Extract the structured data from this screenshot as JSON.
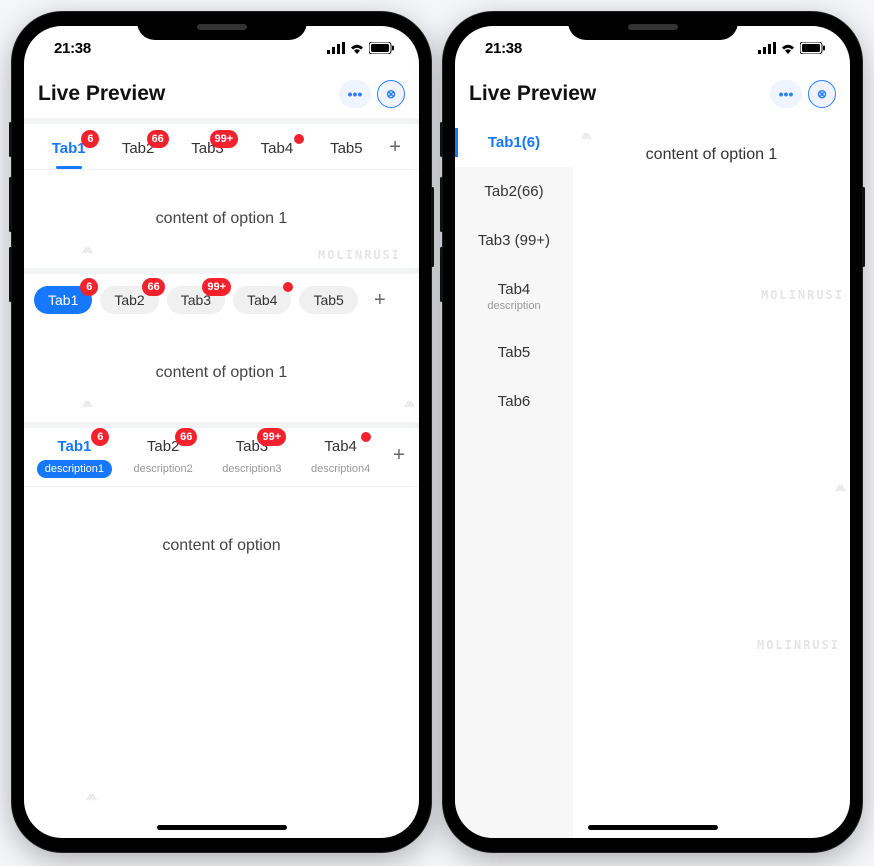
{
  "status": {
    "time": "21:38"
  },
  "header": {
    "title": "Live Preview",
    "more_label": "•••",
    "close_label": "⊗"
  },
  "phone1": {
    "section1": {
      "tabs": [
        {
          "label": "Tab1",
          "badge": "6",
          "active": true
        },
        {
          "label": "Tab2",
          "badge": "66"
        },
        {
          "label": "Tab3",
          "badge": "99+"
        },
        {
          "label": "Tab4",
          "dot": true
        },
        {
          "label": "Tab5"
        }
      ],
      "content": "content of option 1"
    },
    "section2": {
      "pills": [
        {
          "label": "Tab1",
          "badge": "6",
          "active": true
        },
        {
          "label": "Tab2",
          "badge": "66"
        },
        {
          "label": "Tab3",
          "badge": "99+"
        },
        {
          "label": "Tab4",
          "dot": true
        },
        {
          "label": "Tab5"
        }
      ],
      "content": "content of option 1"
    },
    "section3": {
      "tabs": [
        {
          "label": "Tab1",
          "desc": "description1",
          "badge": "6",
          "active": true
        },
        {
          "label": "Tab2",
          "desc": "description2",
          "badge": "66"
        },
        {
          "label": "Tab3",
          "desc": "description3",
          "badge": "99+"
        },
        {
          "label": "Tab4",
          "desc": "description4",
          "dot": true
        }
      ],
      "content": "content of  option"
    },
    "add_label": "+"
  },
  "phone2": {
    "tabs": [
      {
        "label": "Tab1(6)",
        "active": true
      },
      {
        "label": "Tab2(66)"
      },
      {
        "label": "Tab3 (99+)"
      },
      {
        "label": "Tab4",
        "desc": "description"
      },
      {
        "label": "Tab5"
      },
      {
        "label": "Tab6"
      }
    ],
    "content": "content of option 1"
  },
  "watermarks": {
    "brand": "MOLINRUSI",
    "icon": "⩕"
  },
  "colors": {
    "primary": "#1677ff",
    "badge": "#f5222d"
  }
}
